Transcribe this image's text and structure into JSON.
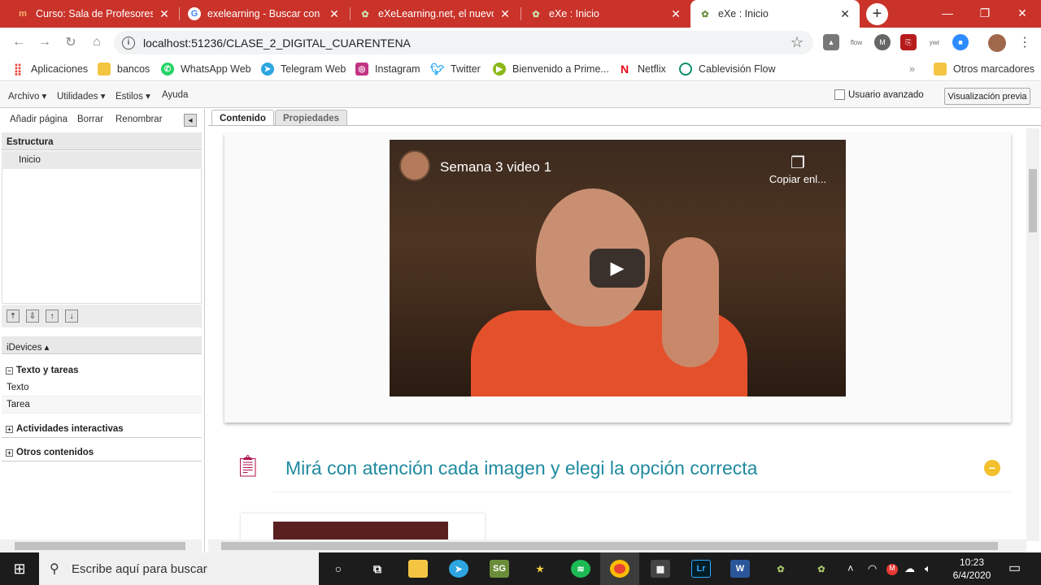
{
  "browser": {
    "tabs": [
      {
        "title": "Curso: Sala de Profesores",
        "icon": "m-icon"
      },
      {
        "title": "exelearning - Buscar con Go",
        "icon": "google-icon"
      },
      {
        "title": "eXeLearning.net, el nuevo e",
        "icon": "exe-icon"
      },
      {
        "title": "eXe : Inicio",
        "icon": "exe-icon"
      },
      {
        "title": "eXe : Inicio",
        "icon": "exe-icon"
      }
    ],
    "new_tab": "+",
    "address": "localhost:51236/CLASE_2_DIGITAL_CUARENTENA",
    "extensions": [
      "drive-icon",
      "flow",
      "m-icon",
      "pdf-icon",
      "ywr",
      "zoom-icon",
      "profile-avatar"
    ],
    "bookmarks": [
      {
        "label": "Aplicaciones",
        "color": "#e94235"
      },
      {
        "label": "bancos",
        "color": "#f4c542"
      },
      {
        "label": "WhatsApp Web",
        "color": "#25d366"
      },
      {
        "label": "Telegram Web",
        "color": "#2ca5e0"
      },
      {
        "label": "Instagram",
        "color": "#c13584"
      },
      {
        "label": "Twitter",
        "color": "#1da1f2"
      },
      {
        "label": "Bienvenido a Prime...",
        "color": "#8ab818"
      },
      {
        "label": "Netflix",
        "color": "#e50914"
      },
      {
        "label": "Cablevisión Flow",
        "color": "#0b8f6b"
      }
    ],
    "more_bookmarks": "»",
    "other_bookmarks": "Otros marcadores"
  },
  "app": {
    "menu": [
      "Archivo ▾",
      "Utilidades ▾",
      "Estilos ▾",
      "Ayuda"
    ],
    "advanced_user": "Usuario avanzado",
    "preview_button": "Visualización previa"
  },
  "left": {
    "actions": [
      "Añadir página",
      "Borrar",
      "Renombrar"
    ],
    "structure_header": "Estructura",
    "tree": [
      "Inicio"
    ],
    "idevices_header": "iDevices ▴",
    "categories": [
      {
        "label": "Texto y tareas",
        "sign": "−",
        "items": [
          "Texto",
          "Tarea"
        ]
      },
      {
        "label": "Actividades interactivas",
        "sign": "+",
        "items": []
      },
      {
        "label": "Otros contenidos",
        "sign": "+",
        "items": []
      }
    ]
  },
  "content": {
    "tabs": [
      "Contenido",
      "Propiedades"
    ],
    "video": {
      "title": "Semana 3 video 1",
      "copy_label": "Copiar enl..."
    },
    "section_title": "Mirá con atención cada imagen y elegi la opción correcta",
    "minimize": "−"
  },
  "taskbar": {
    "search_placeholder": "Escribe aquí para buscar",
    "time": "10:23",
    "date": "6/4/2020"
  }
}
